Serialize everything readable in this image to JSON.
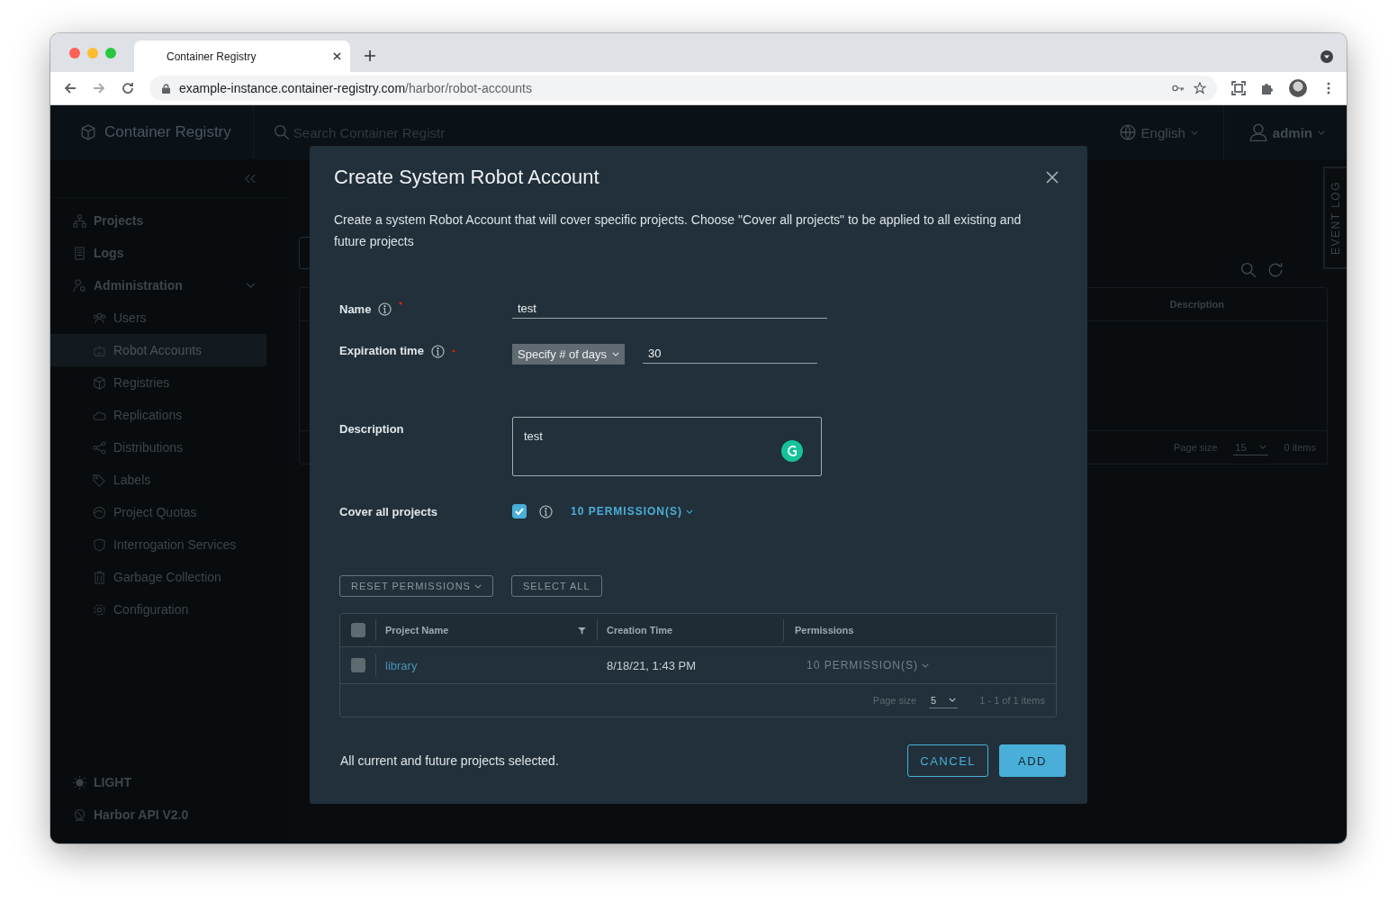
{
  "browser": {
    "tab_title": "Container Registry",
    "url_host": "example-instance.container-registry.com",
    "url_path": "/harbor/robot-accounts"
  },
  "header": {
    "brand": "Container Registry",
    "search_placeholder": "Search Container Registr",
    "language": "English",
    "user": "admin"
  },
  "sidebar": {
    "items": [
      {
        "label": "Projects",
        "selected": false
      },
      {
        "label": "Logs",
        "selected": false
      },
      {
        "label": "Administration",
        "selected": false,
        "expanded": true,
        "children": [
          {
            "label": "Users",
            "selected": false
          },
          {
            "label": "Robot Accounts",
            "selected": true
          },
          {
            "label": "Registries",
            "selected": false
          },
          {
            "label": "Replications",
            "selected": false
          },
          {
            "label": "Distributions",
            "selected": false
          },
          {
            "label": "Labels",
            "selected": false
          },
          {
            "label": "Project Quotas",
            "selected": false
          },
          {
            "label": "Interrogation Services",
            "selected": false
          },
          {
            "label": "Garbage Collection",
            "selected": false
          },
          {
            "label": "Configuration",
            "selected": false
          }
        ]
      }
    ],
    "footer": [
      "LIGHT",
      "Harbor API V2.0"
    ]
  },
  "page": {
    "table_column": "Description",
    "page_size_label": "Page size",
    "page_size": "15",
    "items": "0 items",
    "event_log": "EVENT LOG"
  },
  "modal": {
    "title": "Create System Robot Account",
    "description": "Create a system Robot Account that will cover specific projects. Choose \"Cover all projects\" to be applied to all existing and future projects",
    "name": {
      "label": "Name",
      "required": true,
      "value": "test"
    },
    "expiration": {
      "label": "Expiration time",
      "required": true,
      "select": "Specify # of days",
      "value": "30"
    },
    "desc": {
      "label": "Description",
      "value": "test"
    },
    "cover": {
      "label": "Cover all projects",
      "checked": true,
      "permissions": "10 PERMISSION(S)"
    },
    "actions": [
      "RESET PERMISSIONS",
      "SELECT ALL"
    ],
    "table": {
      "all_checked": false,
      "columns": [
        "Project Name",
        "Creation Time",
        "Permissions"
      ],
      "rows": [
        {
          "name": "library",
          "created": "8/18/21, 1:43 PM",
          "permissions": "10 PERMISSION(S)",
          "checked": false
        }
      ],
      "page_size_label": "Page size",
      "page_size": "5",
      "count": "1 - 1 of 1 items"
    },
    "status": "All current and future projects selected.",
    "cancel": "CANCEL",
    "add": "ADD"
  }
}
